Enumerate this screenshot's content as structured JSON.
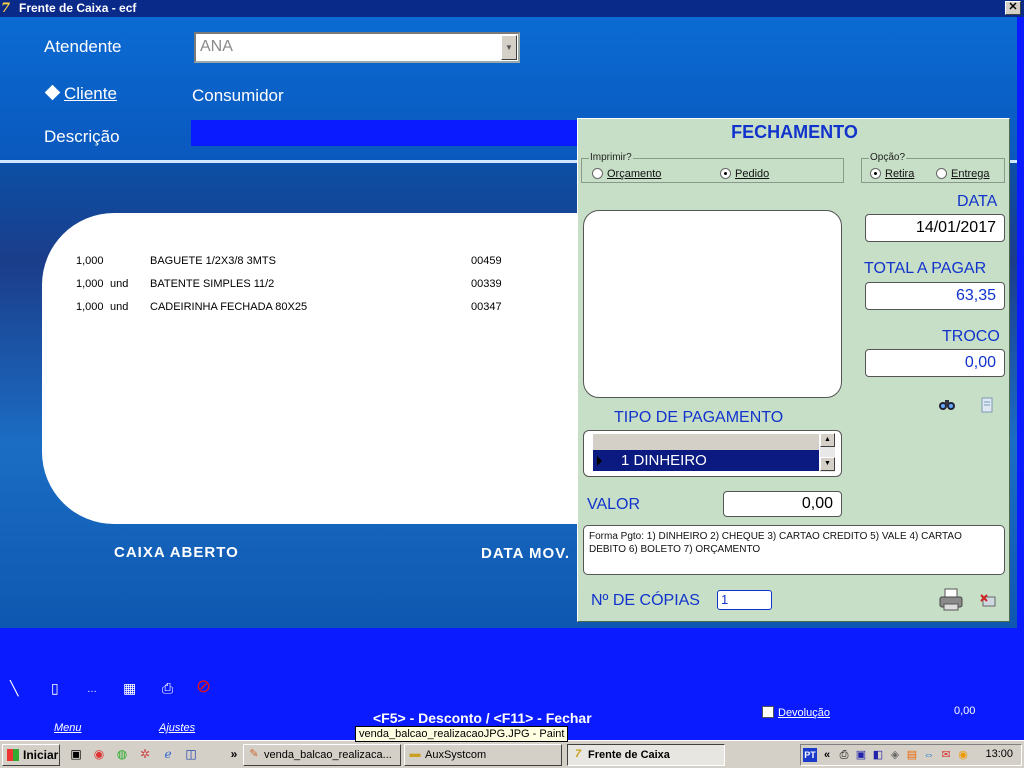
{
  "window": {
    "title": "Frente de Caixa - ecf",
    "close_glyph": "✕"
  },
  "header": {
    "atendente_label": "Atendente",
    "atendente_value": "ANA",
    "cliente_label": "Cliente",
    "cliente_value": "Consumidor",
    "descricao_label": "Descrição"
  },
  "items": [
    {
      "qty": "1,000",
      "unit": "",
      "desc": "BAGUETE 1/2X3/8 3MTS",
      "code": "00459"
    },
    {
      "qty": "1,000",
      "unit": "und",
      "desc": "BATENTE SIMPLES 11/2",
      "code": "00339"
    },
    {
      "qty": "1,000",
      "unit": "und",
      "desc": "CADEIRINHA FECHADA 80X25",
      "code": "00347"
    }
  ],
  "status": {
    "caixa": "CAIXA  ABERTO",
    "data_mov": "DATA MOV."
  },
  "dialog": {
    "title": "FECHAMENTO",
    "imprimir_title": "Imprimir?",
    "imprimir_options": [
      {
        "label": "Orçamento",
        "selected": false
      },
      {
        "label": "Pedido",
        "selected": true
      }
    ],
    "opcao_title": "Opção?",
    "opcao_options": [
      {
        "label": "Retira",
        "selected": true
      },
      {
        "label": "Entrega",
        "selected": false
      }
    ],
    "data_label": "DATA",
    "data_value": "14/01/2017",
    "total_label": "TOTAL A PAGAR",
    "total_value": "63,35",
    "troco_label": "TROCO",
    "troco_value": "0,00",
    "tipo_label": "TIPO DE PAGAMENTO",
    "tipo_selected": "1 DINHEIRO",
    "valor_label": "VALOR",
    "valor_value": "0,00",
    "forma_text": "Forma Pgto:  1) DINHEIRO 2) CHEQUE 3) CARTAO CREDITO 5) VALE 4) CARTAO DEBITO 6) BOLETO 7) ORÇAMENTO",
    "copias_label": "Nº DE CÓPIAS",
    "copias_value": "1"
  },
  "bottom": {
    "menu_label": "Menu",
    "ajustes_label": "Ajustes",
    "shortcut_text": "<F5> - Desconto / <F11> - Fechar",
    "devolucao_label": "Devolução",
    "devolucao_value": "0,00"
  },
  "tooltip": "venda_balcao_realizacaoJPG.JPG - Paint",
  "taskbar": {
    "start_label": "Iniciar",
    "chevron": "»",
    "tasks": [
      {
        "label": "venda_balcao_realizaca...",
        "active": false
      },
      {
        "label": "AuxSystcom",
        "active": false
      },
      {
        "label": "Frente de Caixa",
        "active": true
      }
    ],
    "lang": "PT",
    "tray_chevron": "«",
    "clock": "13:00"
  }
}
